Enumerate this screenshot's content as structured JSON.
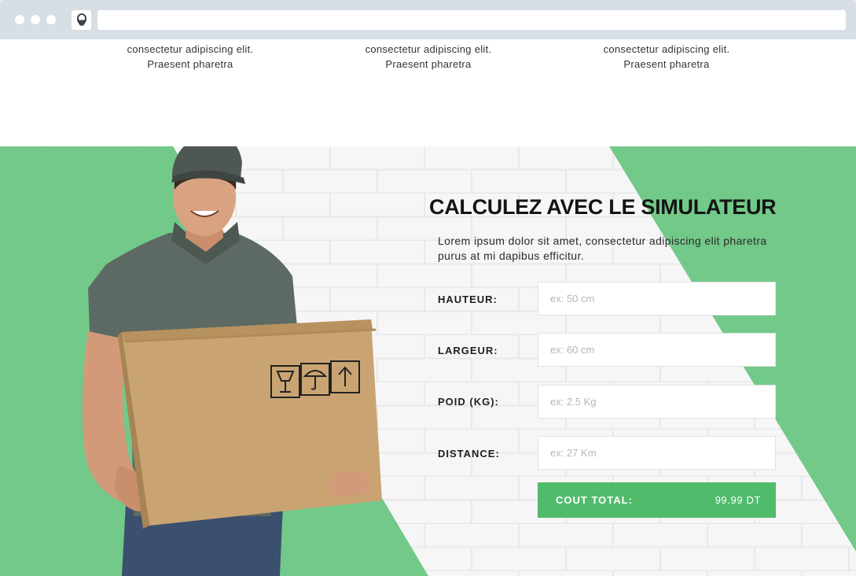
{
  "browser": {
    "url": ""
  },
  "features": [
    {
      "line1": "consectetur adipiscing elit.",
      "line2": "Praesent pharetra"
    },
    {
      "line1": "consectetur adipiscing elit.",
      "line2": "Praesent pharetra"
    },
    {
      "line1": "consectetur adipiscing elit.",
      "line2": "Praesent pharetra"
    }
  ],
  "simulator": {
    "title": "CALCULEZ AVEC LE SIMULATEUR",
    "description": "Lorem ipsum dolor sit amet, consectetur adipiscing elit pharetra purus at mi dapibus efficitur.",
    "fields": [
      {
        "label": "HAUTEUR:",
        "placeholder": "ex: 50 cm",
        "value": ""
      },
      {
        "label": "LARGEUR:",
        "placeholder": "ex: 60 cm",
        "value": ""
      },
      {
        "label": "POID (KG):",
        "placeholder": "ex: 2.5 Kg",
        "value": ""
      },
      {
        "label": "DISTANCE:",
        "placeholder": "ex: 27 Km",
        "value": ""
      }
    ],
    "total_label": "COUT TOTAL:",
    "total_value": "99.99 DT"
  },
  "colors": {
    "accent": "#4fbb6b",
    "accent_light": "#6cc784",
    "chrome": "#d8dee5"
  },
  "icons": [
    "site-logo-icon",
    "fragile-glass-icon",
    "keep-dry-umbrella-icon",
    "this-side-up-icon"
  ]
}
